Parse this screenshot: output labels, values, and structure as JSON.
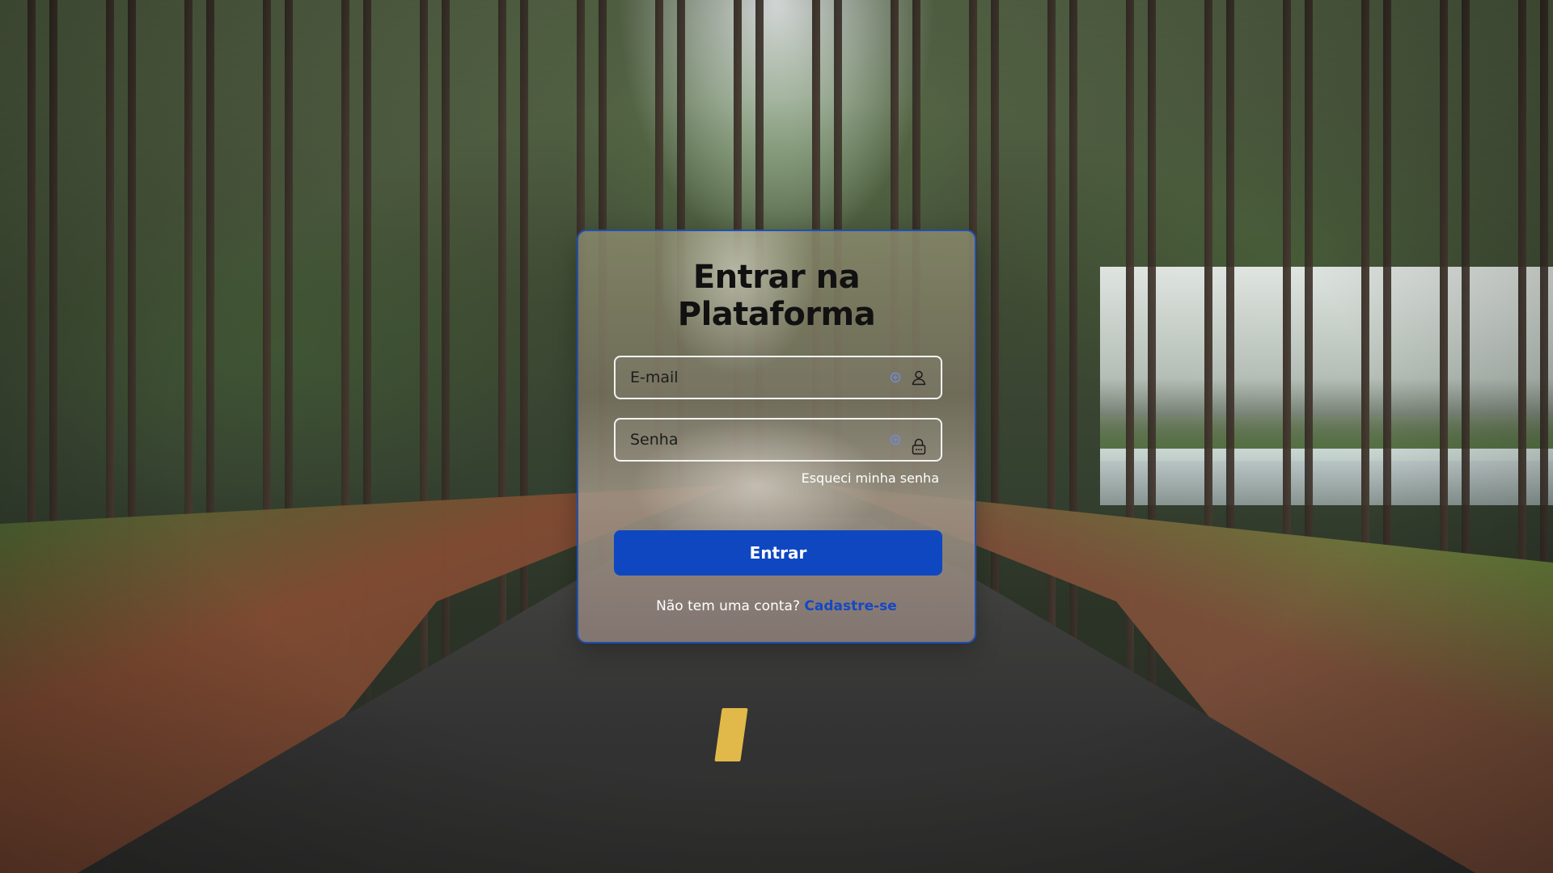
{
  "login": {
    "title": "Entrar na Plataforma",
    "email_placeholder": "E-mail",
    "email_value": "",
    "password_placeholder": "Senha",
    "password_value": "",
    "forgot_password_label": "Esqueci minha senha",
    "submit_label": "Entrar",
    "signup_prompt": "Não tem uma conta?",
    "signup_link_label": "Cadastre-se"
  },
  "icons": {
    "email_field_icon": "user-icon",
    "password_field_icon": "lock-icon",
    "autofill_icon": "password-manager-icon"
  },
  "colors": {
    "accent": "#0f47c0",
    "card_border": "#1f4fb3",
    "signup_link": "#1448c4",
    "title_text": "#111111"
  }
}
